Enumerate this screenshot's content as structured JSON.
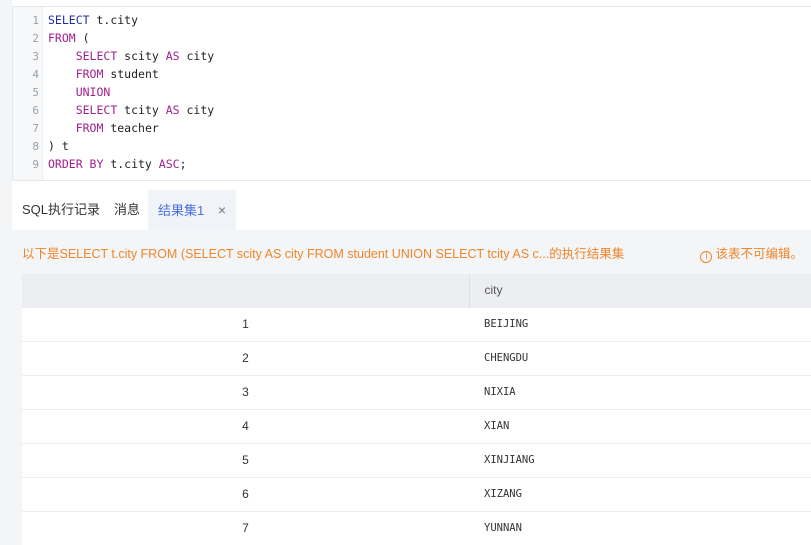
{
  "editor": {
    "lines": [
      {
        "num": "1",
        "parts": [
          [
            "kw2",
            "SELECT "
          ],
          [
            "tx",
            "t.city"
          ]
        ]
      },
      {
        "num": "2",
        "parts": [
          [
            "kw",
            "FROM "
          ],
          [
            "tx",
            "("
          ]
        ]
      },
      {
        "num": "3",
        "parts": [
          [
            "tx",
            "    "
          ],
          [
            "kw",
            "SELECT "
          ],
          [
            "tx",
            "scity "
          ],
          [
            "kw",
            "AS "
          ],
          [
            "tx",
            "city"
          ]
        ]
      },
      {
        "num": "4",
        "parts": [
          [
            "tx",
            "    "
          ],
          [
            "kw",
            "FROM "
          ],
          [
            "tx",
            "student"
          ]
        ]
      },
      {
        "num": "5",
        "parts": [
          [
            "tx",
            "    "
          ],
          [
            "kw",
            "UNION"
          ]
        ]
      },
      {
        "num": "6",
        "parts": [
          [
            "tx",
            "    "
          ],
          [
            "kw",
            "SELECT "
          ],
          [
            "tx",
            "tcity "
          ],
          [
            "kw",
            "AS "
          ],
          [
            "tx",
            "city"
          ]
        ]
      },
      {
        "num": "7",
        "parts": [
          [
            "tx",
            "    "
          ],
          [
            "kw",
            "FROM "
          ],
          [
            "tx",
            "teacher"
          ]
        ]
      },
      {
        "num": "8",
        "parts": [
          [
            "tx",
            ") t"
          ]
        ]
      },
      {
        "num": "9",
        "parts": [
          [
            "kw",
            "ORDER BY "
          ],
          [
            "tx",
            "t.city "
          ],
          [
            "kw",
            "ASC"
          ],
          [
            "tx",
            ";"
          ]
        ]
      }
    ]
  },
  "tabs": {
    "history": "SQL执行记录",
    "messages": "消息",
    "result": "结果集1",
    "close_glyph": "×"
  },
  "result": {
    "notice": "以下是SELECT t.city FROM (SELECT scity AS city FROM student UNION SELECT tcity AS c...的执行结果集",
    "readonly_notice": "该表不可编辑。",
    "info_glyph": "i",
    "columns": [
      "",
      "city"
    ],
    "rows": [
      {
        "index": "1",
        "city": "BEIJING"
      },
      {
        "index": "2",
        "city": "CHENGDU"
      },
      {
        "index": "3",
        "city": "NIXIA"
      },
      {
        "index": "4",
        "city": "XIAN"
      },
      {
        "index": "5",
        "city": "XINJIANG"
      },
      {
        "index": "6",
        "city": "XIZANG"
      },
      {
        "index": "7",
        "city": "YUNNAN"
      }
    ]
  },
  "colors": {
    "accent": "#4a6ee0",
    "warning": "#f0852a",
    "keyword": "#a0208e"
  }
}
